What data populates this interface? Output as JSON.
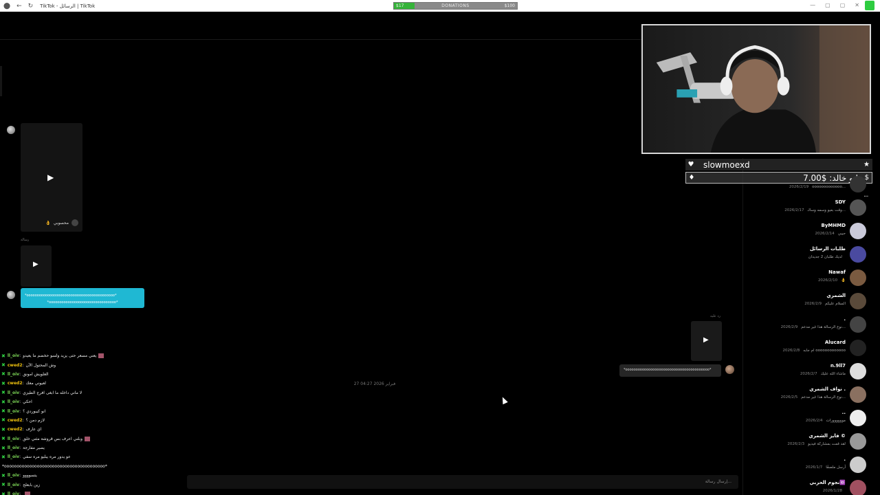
{
  "window": {
    "title": "TikTok - الرسائل | TikTok"
  },
  "donation": {
    "current": "$17",
    "label": "DONATIONS",
    "goal": "$100",
    "progress": 0.17
  },
  "conversation": {
    "video_author": "محسوبي",
    "small_label_1": "رسالة",
    "small_label_2": "رد عليه",
    "cyan_message_line1": "*oooooooooooooooooooooooooooooooooooooooooo*",
    "cyan_message_line2": "*oooooooooooooooooooooooooooooooo*",
    "grey_message": "*oooooooooooooooooooooooooooooooooooooooo*",
    "date_divider": "27 فبراير 2026 04:27"
  },
  "chat": [
    {
      "user": "ll_oiv",
      "msg": "يعني مسعر حتى يزيد ولسو حخضم ما يعيدو",
      "color": "#7ed957",
      "badge": true
    },
    {
      "user": "cwed2",
      "msg": "وش المحتول الآن",
      "color": "#f1c40f",
      "badge": false
    },
    {
      "user": "ll_oiv",
      "msg": "العلويش امونق",
      "color": "#7ed957",
      "badge": false
    },
    {
      "user": "cwed2",
      "msg": "لعيوني معك",
      "color": "#f1c40f",
      "badge": false
    },
    {
      "user": "ll_oiv",
      "msg": "لا ماني داخله ما ابغى افرج الطيزي",
      "color": "#7ed957",
      "badge": false
    },
    {
      "user": "ll_oiv",
      "msg": "احكي",
      "color": "#7ed957",
      "badge": false
    },
    {
      "user": "ll_oiv",
      "msg": "انو كيبوردي ؟",
      "color": "#7ed957",
      "badge": false
    },
    {
      "user": "cwed2",
      "msg": "لازم دمن ؟",
      "color": "#f1c40f",
      "badge": false
    },
    {
      "user": "cwed2",
      "msg": "اي عارف",
      "color": "#f1c40f",
      "badge": false
    },
    {
      "user": "ll_oiv",
      "msg": "وبلني اعرف بس قروشة مثني خلق",
      "color": "#7ed957",
      "badge": true
    },
    {
      "user": "ll_oiv",
      "msg": "يصير مفارجة",
      "color": "#7ed957",
      "badge": false
    },
    {
      "user": "ll_oiv",
      "msg": "عو يدور مره يبليو مره سفي",
      "color": "#7ed957",
      "badge": false
    },
    {
      "user": "",
      "msg": "*oooooooooooooooooooooooooooooooooooooooo*",
      "color": "#fff",
      "badge": false
    },
    {
      "user": "ll_oiv",
      "msg": "يتسوووو",
      "color": "#7ed957",
      "badge": false
    },
    {
      "user": "ll_oiv",
      "msg": "زين بابعلح",
      "color": "#7ed957",
      "badge": false
    },
    {
      "user": "ll_oiv",
      "msg": "",
      "color": "#7ed957",
      "badge": true
    }
  ],
  "input": {
    "placeholder": "إرسال رسالة..."
  },
  "webcam": {
    "alt": "streamer webcam"
  },
  "tips": {
    "follower": "slowmoexd",
    "donation": "ابو خالد: $7.00"
  },
  "conversations": [
    {
      "name": "",
      "preview": "ooooooooooooo...",
      "date": "2026/2/19"
    },
    {
      "name": "SDY",
      "preview": "وقت بعيو وسمه وسالـ...",
      "date": "2026/2/17"
    },
    {
      "name": "ByMHMD",
      "preview": "حيبي",
      "date": "2026/2/14"
    },
    {
      "name": "طلبات الرسائل",
      "preview": "لديك طلبان 2 جديدان",
      "date": ""
    },
    {
      "name": "Nawaf",
      "preview": "👌",
      "date": "2026/2/10"
    },
    {
      "name": "الشمري",
      "preview": "السلام عليكم",
      "date": "2026/2/9"
    },
    {
      "name": ".",
      "preview": "نوع الرسالة هذا غير مدعم...",
      "date": "2026/2/9"
    },
    {
      "name": "Alucard",
      "preview": "ام جابه ooooooooooooo",
      "date": "2026/2/8"
    },
    {
      "name": "n.9ll7",
      "preview": "ماشاء الله عليك",
      "date": "2026/2/7"
    },
    {
      "name": "نواف الشمري .",
      "preview": "نوع الرسالة هذا غير مدعم...",
      "date": "2026/2/5"
    },
    {
      "name": "..",
      "preview": "موووووورات",
      "date": "2026/2/4"
    },
    {
      "name": "فايز الشمري ©",
      "preview": "لقد قمت بمشاركة فيديو",
      "date": "2026/2/3"
    },
    {
      "name": ".",
      "preview": "أرسل ملصقًا",
      "date": "2026/1/7"
    },
    {
      "name": "نجوم الحربي🆔",
      "preview": "",
      "date": "2026/1/28"
    }
  ]
}
